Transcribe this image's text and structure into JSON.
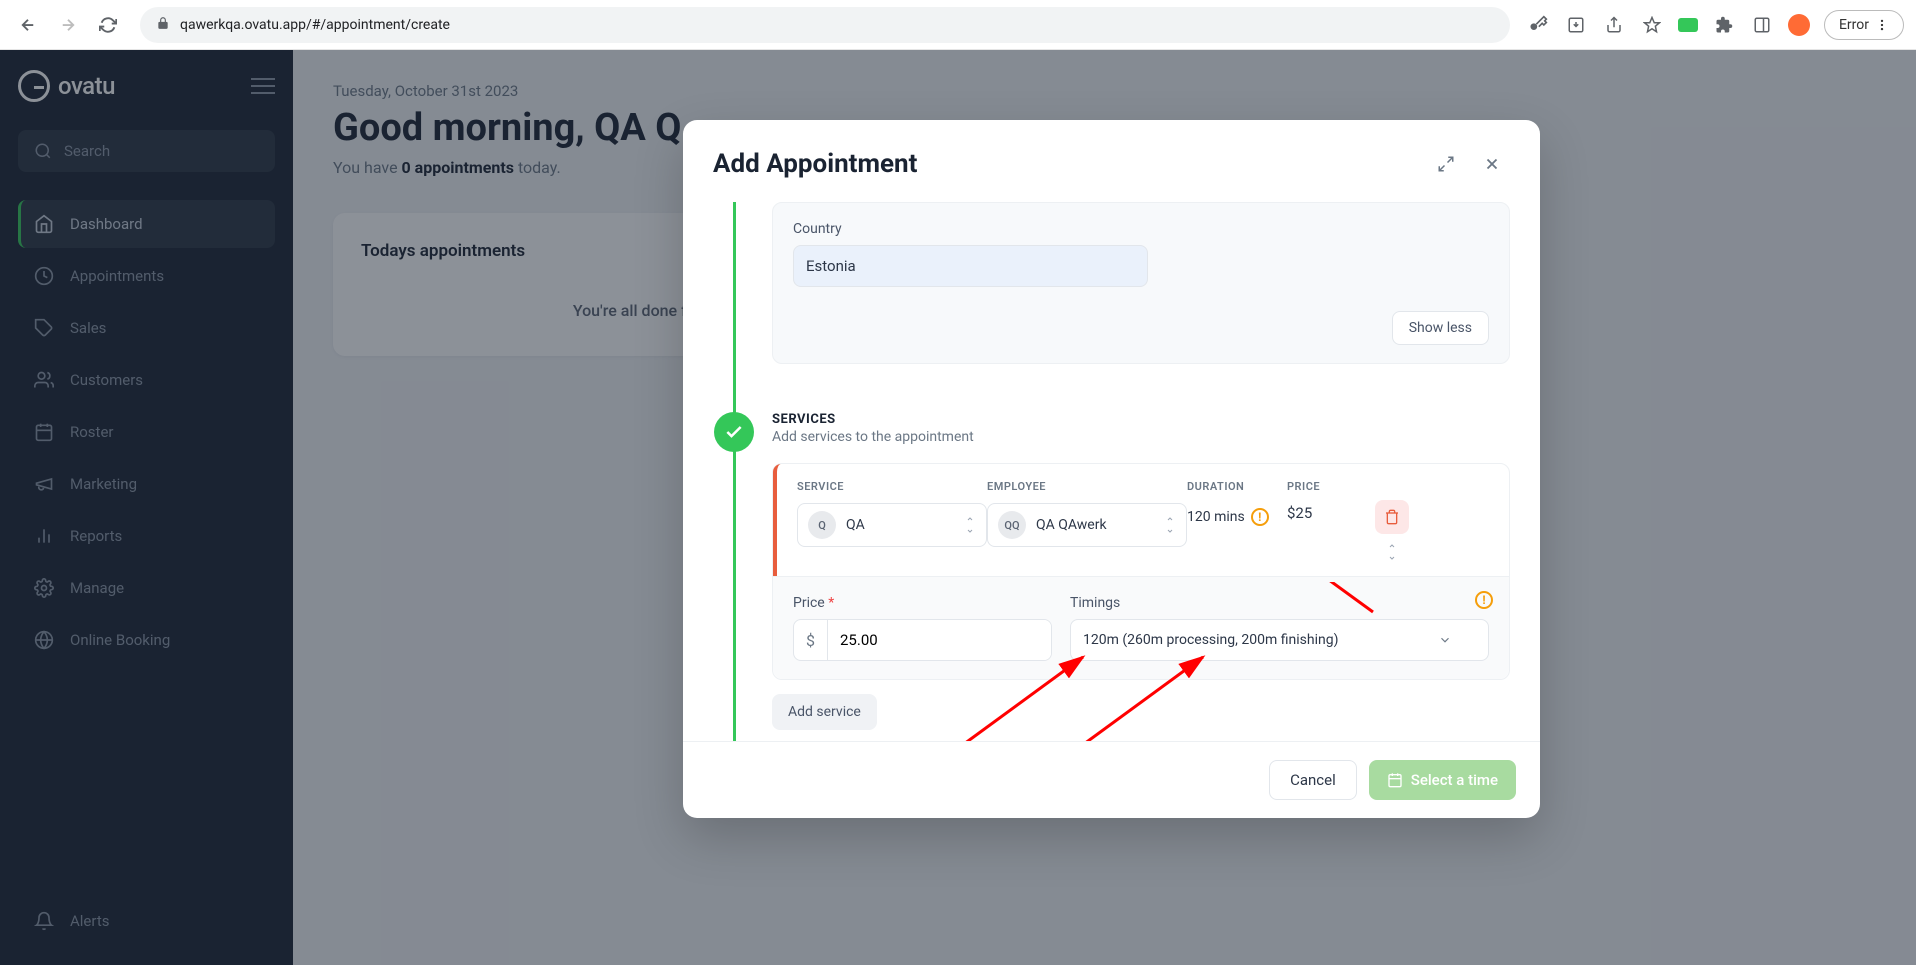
{
  "browser": {
    "url": "qawerkqa.ovatu.app/#/appointment/create",
    "error_label": "Error"
  },
  "app": {
    "logo": "ovatu",
    "search_placeholder": "Search",
    "nav": {
      "dashboard": "Dashboard",
      "appointments": "Appointments",
      "sales": "Sales",
      "customers": "Customers",
      "roster": "Roster",
      "marketing": "Marketing",
      "reports": "Reports",
      "manage": "Manage",
      "online_booking": "Online Booking",
      "alerts": "Alerts"
    }
  },
  "main": {
    "date": "Tuesday, October 31st 2023",
    "greeting": "Good morning, QA Q",
    "sub_prefix": "You have ",
    "sub_count": "0 appointments",
    "sub_suffix": " today.",
    "card_title": "Todays appointments",
    "empty": "You're all done for today! 🎉"
  },
  "modal": {
    "title": "Add Appointment",
    "country_label": "Country",
    "country_value": "Estonia",
    "show_less": "Show less",
    "services": {
      "heading": "SERVICES",
      "sub": "Add services to the appointment",
      "cols": {
        "service": "SERVICE",
        "employee": "EMPLOYEE",
        "duration": "DURATION",
        "price": "PRICE"
      },
      "row": {
        "service_badge": "Q",
        "service_name": "QA",
        "employee_badge": "QQ",
        "employee_name": "QA QAwerk",
        "duration": "120 mins",
        "price": "$25"
      },
      "price_label": "Price",
      "price_currency": "$",
      "price_value": "25.00",
      "timings_label": "Timings",
      "timings_value": "120m (260m processing, 200m finishing)",
      "add_button": "Add service"
    },
    "footer": {
      "cancel": "Cancel",
      "submit": "Select a time"
    }
  }
}
